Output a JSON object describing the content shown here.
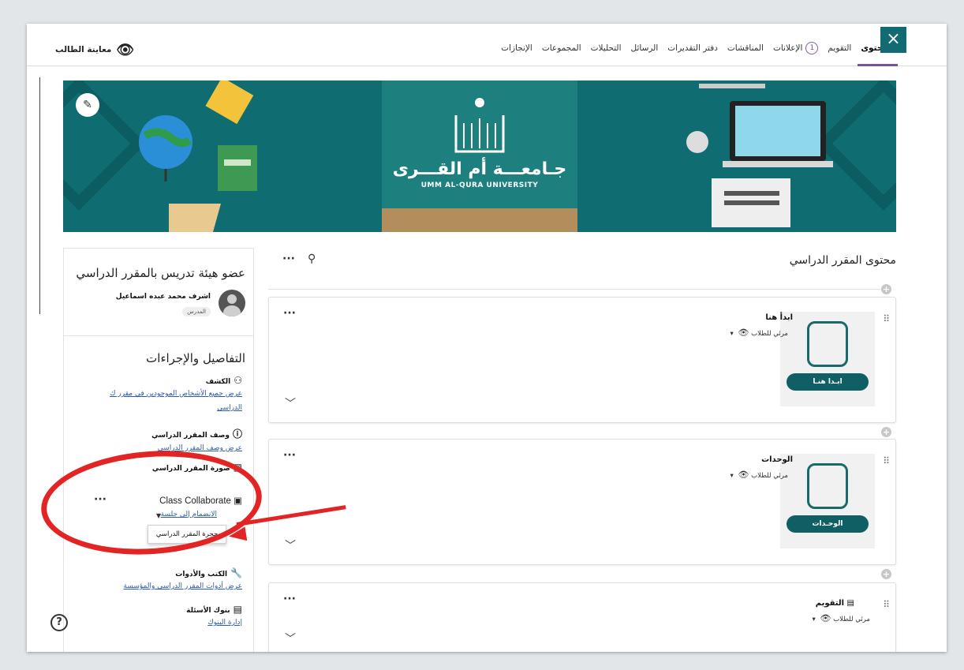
{
  "close_icon": "×",
  "tabs": [
    {
      "label": "المحتوى",
      "active": true
    },
    {
      "label": "التقويم"
    },
    {
      "label": "الإعلانات",
      "badge": "1"
    },
    {
      "label": "المناقشات"
    },
    {
      "label": "دفتر التقديرات"
    },
    {
      "label": "الرسائل"
    },
    {
      "label": "التحليلات"
    },
    {
      "label": "المجموعات"
    },
    {
      "label": "الإنجازات"
    }
  ],
  "preview_label": "معاينة الطالب",
  "banner": {
    "logo_arabic": "جـامعـــة أم القـــرى",
    "logo_english": "UMM AL-QURA UNIVERSITY"
  },
  "instructor": {
    "section_title": "عضو هيئة تدريس بالمقرر الدراسي",
    "name": "اشرف محمد عبده اسماعيل",
    "role": "المدرس"
  },
  "details": {
    "title": "التفاصيل والإجراءات",
    "roster": {
      "heading": "الكشف",
      "link_1": "عرض جميع الأشخاص الموجودين في مقرر ك",
      "link_2": "الدراسي"
    },
    "description": {
      "heading": "وصف المقرر الدراسي",
      "link": "عرض وصف المقرر الدراسي"
    },
    "image": {
      "heading": "صورة المقرر الدراسي"
    },
    "collaborate": {
      "heading": "Class Collaborate",
      "link": "الانضمام إلى جلسة",
      "dropdown_item": "حجرة المقرر الدراسي"
    },
    "books": {
      "heading": "الكتب والأدوات",
      "link": "عرض أدوات المقرر الدراسي والمؤسسة"
    },
    "banks": {
      "heading": "بنوك الأسئلة",
      "link": "إدارة البنوك"
    }
  },
  "content": {
    "title": "محتوى المقرر الدراسي",
    "items": [
      {
        "title": "ابدأ هنا",
        "visibility": "مرئي للطلاب",
        "thumb_label": "ابـدا هنـا"
      },
      {
        "title": "الوحدات",
        "visibility": "مرئي للطلاب",
        "thumb_label": "الوحـدات"
      },
      {
        "title": "التقويم",
        "visibility": "مرئي للطلاب"
      }
    ]
  }
}
